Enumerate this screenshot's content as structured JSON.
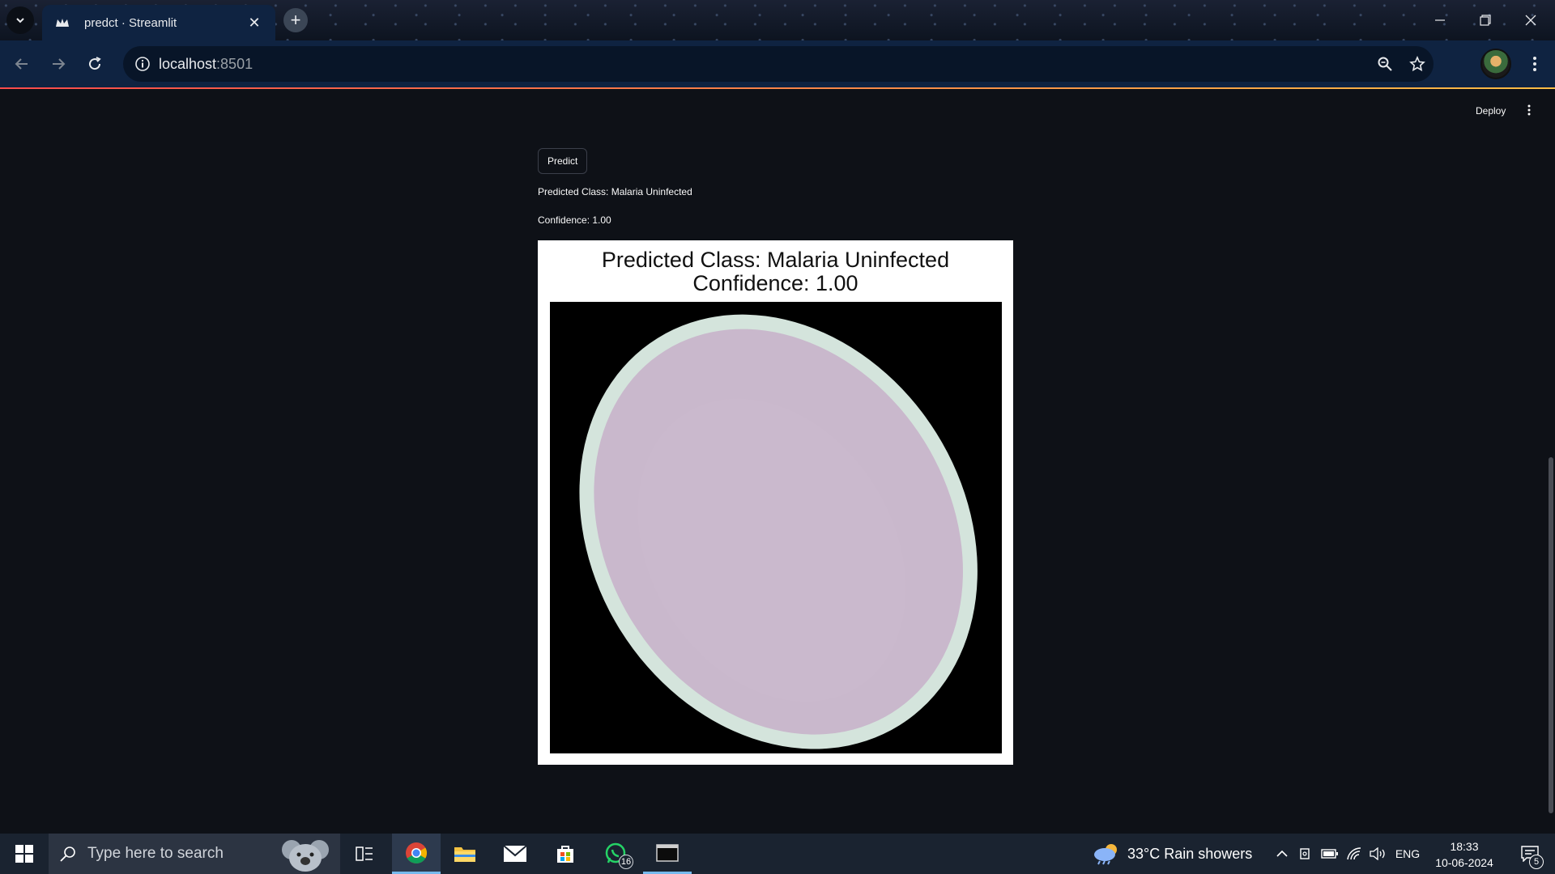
{
  "browser": {
    "tab_title": "predct · Streamlit",
    "url_host": "localhost",
    "url_port": ":8501"
  },
  "app": {
    "deploy_label": "Deploy",
    "predict_button": "Predict",
    "predicted_class_text": "Predicted Class: Malaria Uninfected",
    "confidence_text": "Confidence: 1.00",
    "figure_title_line1": "Predicted Class: Malaria Uninfected",
    "figure_title_line2": "Confidence: 1.00",
    "colors": {
      "background": "#0e1117",
      "cell": "#c8b8cc",
      "cell_border": "#cfe0d8"
    }
  },
  "taskbar": {
    "search_placeholder": "Type here to search",
    "whatsapp_badge": "16",
    "weather": "33°C  Rain showers",
    "language": "ENG",
    "time": "18:33",
    "date": "10-06-2024",
    "notifications": "5"
  }
}
